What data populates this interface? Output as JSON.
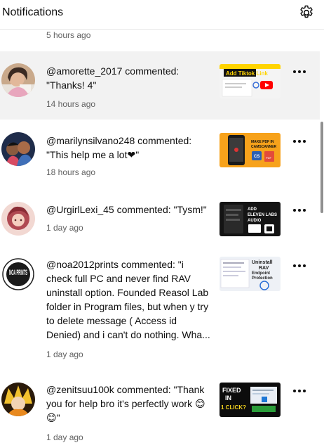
{
  "header": {
    "title": "Notifications",
    "settings_icon": "gear-icon"
  },
  "partial_item": {
    "time": "5 hours ago"
  },
  "notifications": [
    {
      "comment": "@amorette_2017 commented: \"Thanks! 4\"",
      "time": "14 hours ago",
      "highlighted": true,
      "thumbnail_text": "Add Tiktok Link"
    },
    {
      "comment": "@marilynsilvano248 commented: \"This help me a lot❤\"",
      "time": "18 hours ago",
      "highlighted": false,
      "thumbnail_text": "MAKE PDF IN CAMSCANNER"
    },
    {
      "comment": "@UrgirlLexi_45 commented: \"Tysm!\"",
      "time": "1 day ago",
      "highlighted": false,
      "thumbnail_text": "ADD ELEVEN LABS AUDIO"
    },
    {
      "comment": "@noa2012prints commented: \"i check full PC and never find RAV uninstall option. Founded Reasol Lab folder in Program files, but when y try to delete message ( Access id Denied) and i can't do nothing. Wha...",
      "time": "1 day ago",
      "highlighted": false,
      "avatar_text": "NOA PRINTS",
      "thumbnail_text": "Uninstall RAV Endpoint Protection"
    },
    {
      "comment": "@zenitsuu100k commented: \"Thank you for help bro it's perfectly work 😊😊\"",
      "time": "1 day ago",
      "highlighted": false,
      "thumbnail_text": "FIXED IN 1 CLICK?"
    }
  ]
}
